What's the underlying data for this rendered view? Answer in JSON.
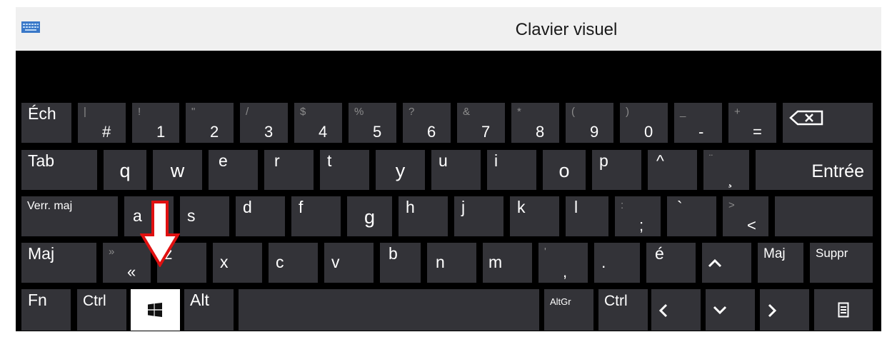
{
  "window": {
    "title": "Clavier visuel",
    "icon": "keyboard-icon"
  },
  "keys": {
    "esc": "Éch",
    "digits": [
      {
        "sec": "|",
        "pri": "#"
      },
      {
        "sec": "!",
        "pri": "1"
      },
      {
        "sec": "\"",
        "pri": "2"
      },
      {
        "sec": "/",
        "pri": "3"
      },
      {
        "sec": "$",
        "pri": "4"
      },
      {
        "sec": "%",
        "pri": "5"
      },
      {
        "sec": "?",
        "pri": "6"
      },
      {
        "sec": "&",
        "pri": "7"
      },
      {
        "sec": "*",
        "pri": "8"
      },
      {
        "sec": "(",
        "pri": "9"
      },
      {
        "sec": ")",
        "pri": "0"
      },
      {
        "sec": "_",
        "pri": "-"
      },
      {
        "sec": "+",
        "pri": "="
      }
    ],
    "backspace_icon": "backspace-icon",
    "tab": "Tab",
    "row2": [
      "q",
      "w",
      "e",
      "r",
      "t",
      "y",
      "u",
      "i",
      "o",
      "p",
      "^"
    ],
    "diaeresis": {
      "sec": "¨",
      "pri": "¸"
    },
    "enter": "Entrée",
    "caps": "Verr. maj",
    "row3": [
      "a",
      "s",
      "d",
      "f",
      "g",
      "h",
      "j",
      "k",
      "l"
    ],
    "semicolon": {
      "sec": ":",
      "pri": ";"
    },
    "grave": "`",
    "less": {
      "sec": ">",
      "pri": "<"
    },
    "shift_left": "Maj",
    "guillemet": {
      "sec": "»",
      "pri": "«"
    },
    "row4": [
      "z",
      "x",
      "c",
      "v",
      "b",
      "n",
      "m"
    ],
    "comma": {
      "sec": "'",
      "pri": ","
    },
    "period": ".",
    "e_acute": "é",
    "up_icon": "arrow-up-icon",
    "shift_right": "Maj",
    "delete": "Suppr",
    "fn": "Fn",
    "ctrl_left": "Ctrl",
    "windows_icon": "windows-logo-icon",
    "alt": "Alt",
    "altgr": "AltGr",
    "ctrl_right": "Ctrl",
    "left_icon": "arrow-left-icon",
    "down_icon": "arrow-down-icon",
    "right_icon": "arrow-right-icon",
    "menu_icon": "menu-icon"
  },
  "annotation": {
    "arrow_icon": "red-down-arrow-icon",
    "color": "#e01010"
  },
  "colors": {
    "key_bg": "#333338",
    "panel_bg": "#000000",
    "title_bg": "#f0f0f0"
  }
}
